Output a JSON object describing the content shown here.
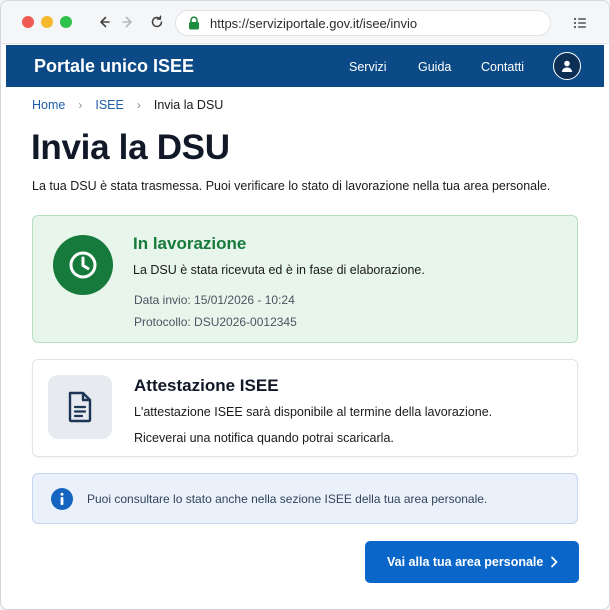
{
  "browser": {
    "url": "https://serviziportale.gov.it/isee/invio"
  },
  "header": {
    "title": "Portale unico ISEE",
    "nav": [
      "Servizi",
      "Guida",
      "Contatti"
    ]
  },
  "breadcrumb": {
    "items": [
      "Home",
      "ISEE",
      "Invia la DSU"
    ]
  },
  "page": {
    "title": "Invia la DSU",
    "subtitle": "La tua DSU è stata trasmessa. Puoi verificare lo stato di lavorazione nella tua area personale."
  },
  "status_card": {
    "title": "In lavorazione",
    "description": "La DSU è stata ricevuta ed è in fase di elaborazione.",
    "date": "Data invio: 15/01/2026 - 10:24",
    "protocol": "Protocollo: DSU2026-0012345"
  },
  "isee_card": {
    "title": "Attestazione ISEE",
    "line1": "L'attestazione ISEE sarà disponibile al termine della lavorazione.",
    "line2": "Riceverai una notifica quando potrai scaricarla."
  },
  "info": {
    "text": "Puoi consultare lo stato anche nella sezione ISEE della tua area personale."
  },
  "cta": {
    "label": "Vai alla tua area personale"
  },
  "icons": {
    "clock": "clock-icon",
    "document": "document-icon",
    "info": "info-icon",
    "user": "user-icon",
    "lock": "lock-icon"
  },
  "colors": {
    "header_bg": "#0b4a86",
    "status_green": "#157a3c",
    "status_bg": "#e8f5ea",
    "info_blue": "#1565c0",
    "cta_blue": "#0a66c8"
  }
}
